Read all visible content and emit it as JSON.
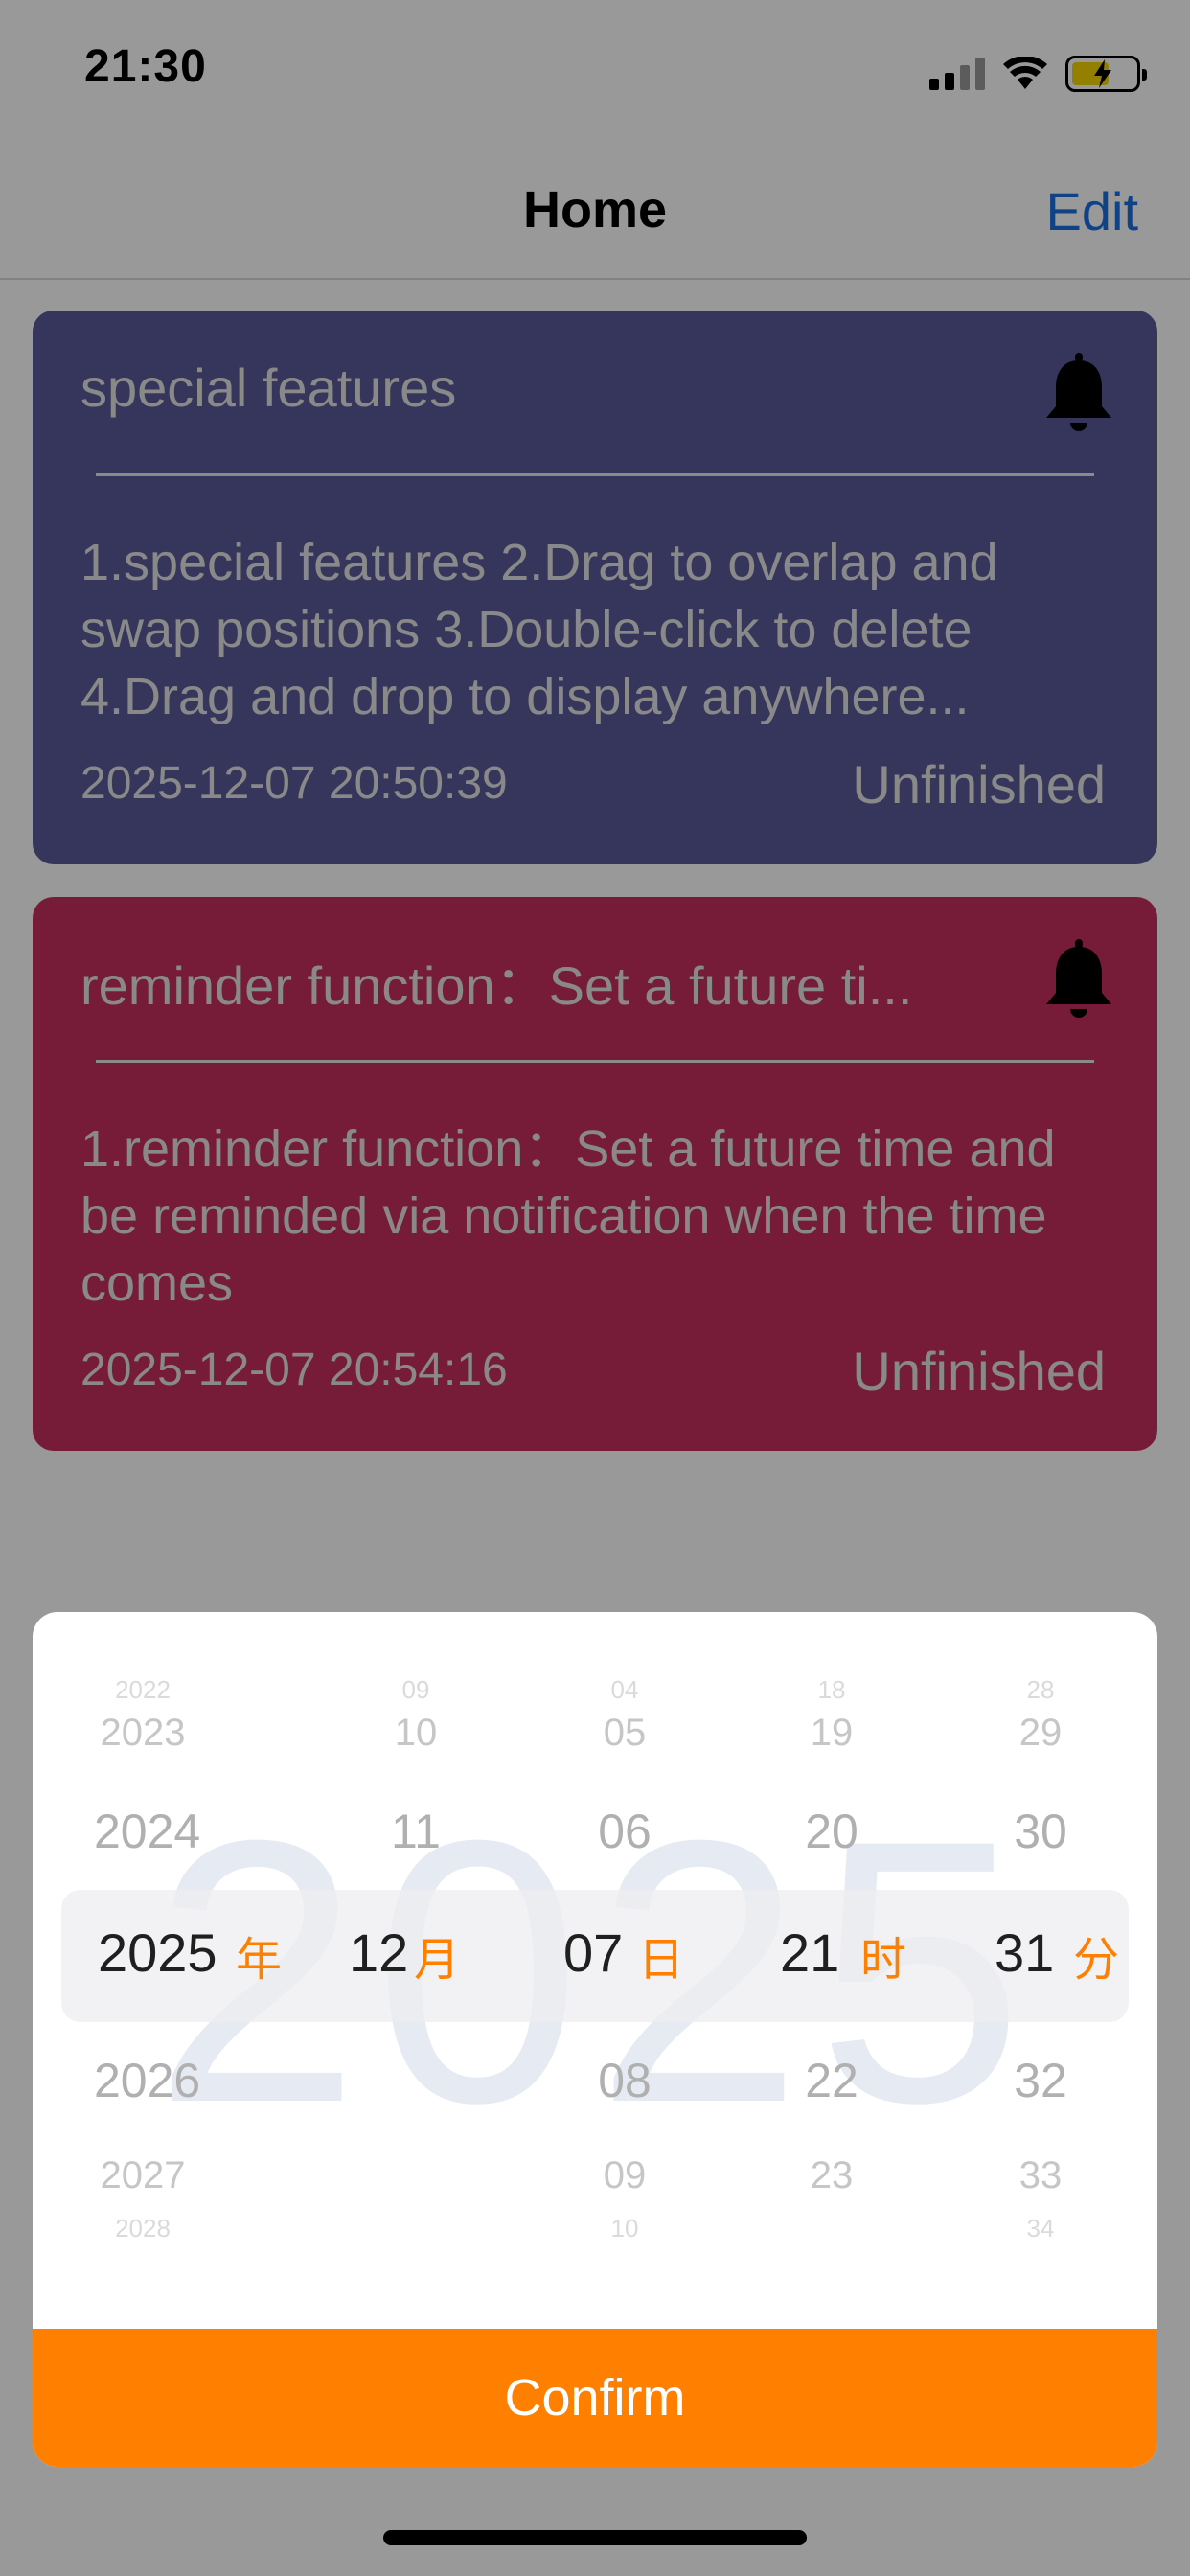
{
  "status_bar": {
    "time": "21:30"
  },
  "nav": {
    "title": "Home",
    "edit_label": "Edit"
  },
  "cards": [
    {
      "title": "special features",
      "body": "1.special features  2.Drag to overlap and swap positions  3.Double-click to delete 4.Drag and drop to display anywhere...",
      "date": "2025-12-07 20:50:39",
      "status": "Unfinished",
      "color": "#5a5a99"
    },
    {
      "title": "reminder function：Set a future ti...",
      "body": "1.reminder function：Set a future time and be reminded via notification when the time comes",
      "date": "2025-12-07 20:54:16",
      "status": "Unfinished",
      "color": "#c5305f"
    }
  ],
  "picker": {
    "watermark": "2025",
    "columns": {
      "year": {
        "unit": "年",
        "values": [
          "2022",
          "2023",
          "2024",
          "2025",
          "2026",
          "2027",
          "2028"
        ]
      },
      "month": {
        "unit": "月",
        "values": [
          "09",
          "10",
          "11",
          "12",
          "",
          "",
          ""
        ]
      },
      "day": {
        "unit": "日",
        "values": [
          "04",
          "05",
          "06",
          "07",
          "08",
          "09",
          "10"
        ]
      },
      "hour": {
        "unit": "时",
        "values": [
          "18",
          "19",
          "20",
          "21",
          "22",
          "23",
          ""
        ]
      },
      "minute": {
        "unit": "分",
        "values": [
          "28",
          "29",
          "30",
          "31",
          "32",
          "33",
          "34"
        ]
      }
    },
    "confirm_label": "Confirm",
    "accent_color": "#ff7f00"
  }
}
